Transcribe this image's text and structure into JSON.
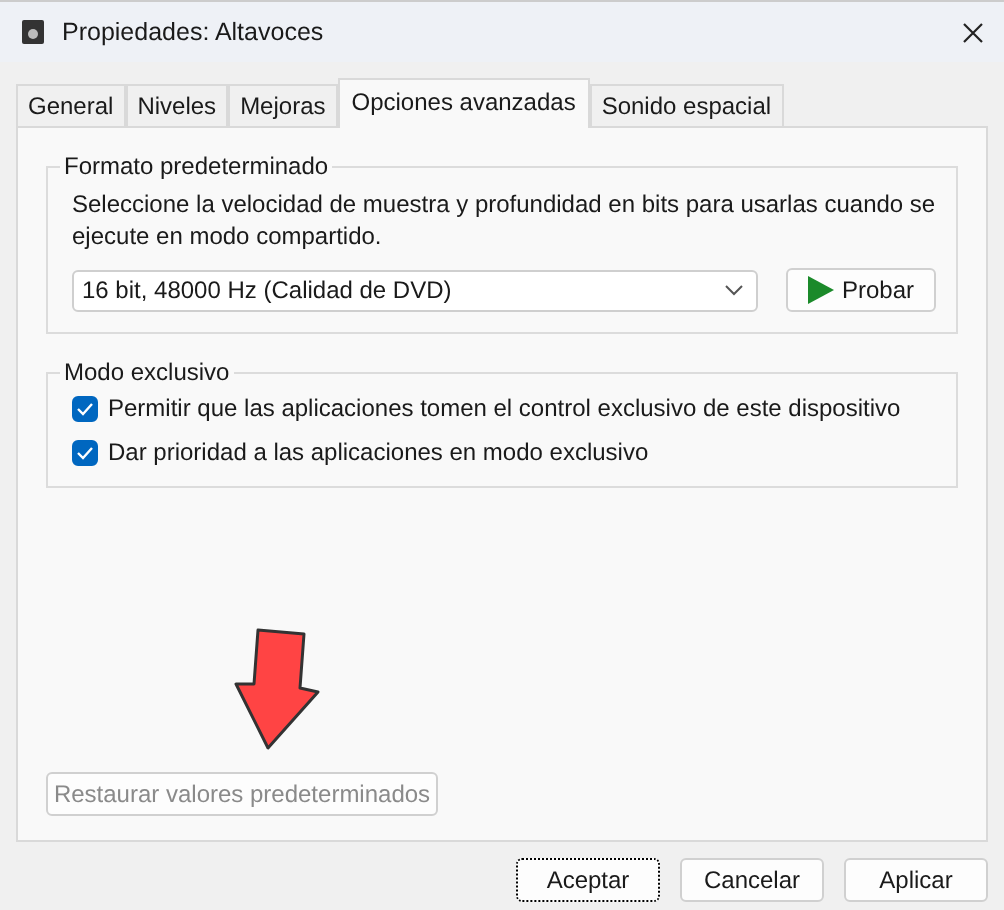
{
  "window": {
    "title": "Propiedades: Altavoces"
  },
  "tabs": [
    {
      "label": "General",
      "selected": false
    },
    {
      "label": "Niveles",
      "selected": false
    },
    {
      "label": "Mejoras",
      "selected": false
    },
    {
      "label": "Opciones avanzadas",
      "selected": true
    },
    {
      "label": "Sonido espacial",
      "selected": false
    }
  ],
  "default_format": {
    "title": "Formato predeterminado",
    "description": "Seleccione la velocidad de muestra y profundidad en bits para usarlas cuando se ejecute en modo compartido.",
    "format_select": {
      "value": "16 bit, 48000 Hz (Calidad de DVD)"
    },
    "test_button": {
      "label": "Probar"
    }
  },
  "exclusive_mode": {
    "title": "Modo exclusivo",
    "options": [
      {
        "label": "Permitir que las aplicaciones tomen el control exclusivo de este dispositivo",
        "checked": true
      },
      {
        "label": "Dar prioridad a las aplicaciones en modo exclusivo",
        "checked": true
      }
    ]
  },
  "restore_button": {
    "label": "Restaurar valores predeterminados",
    "disabled": true
  },
  "buttons": [
    {
      "label": "Aceptar",
      "focused": true
    },
    {
      "label": "Cancelar",
      "focused": false
    },
    {
      "label": "Aplicar",
      "focused": false
    }
  ]
}
